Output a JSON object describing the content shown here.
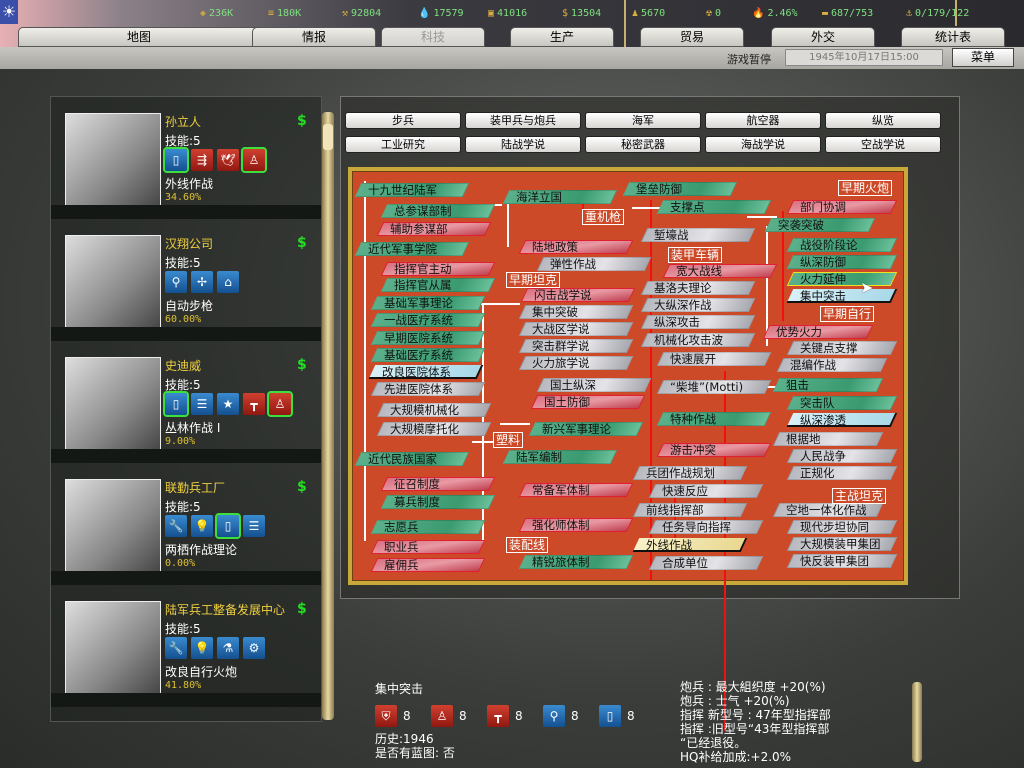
{
  "topbar": {
    "resources": [
      {
        "icon": "energy-icon",
        "value": "236K"
      },
      {
        "icon": "metal-icon",
        "value": "180K"
      },
      {
        "icon": "rare-materials-icon",
        "value": "92804"
      },
      {
        "icon": "oil-icon",
        "value": "17579"
      },
      {
        "icon": "supplies-icon",
        "value": "41016"
      },
      {
        "icon": "money-icon",
        "value": "13504"
      },
      {
        "icon": "manpower-icon",
        "value": "5670"
      },
      {
        "icon": "nuclear-icon",
        "value": "0"
      },
      {
        "icon": "dissent-icon",
        "value": "2.46%"
      },
      {
        "icon": "transport-icon",
        "value": "687/753"
      },
      {
        "icon": "convoy-icon",
        "value": "0/179/122"
      }
    ],
    "tabs": [
      "地图",
      "情报",
      "科技",
      "生产",
      "贸易",
      "外交",
      "统计表"
    ],
    "active_tab": "科技",
    "pause_label": "游戏暂停",
    "date": "1945年10月17日15:00",
    "menu_label": "菜单"
  },
  "teams": [
    {
      "name": "孙立人",
      "skill": "技能:5",
      "project": "外线作战",
      "progress": "34.60%",
      "icons": [
        [
          "book",
          "blue",
          true
        ],
        [
          "infantry-split",
          "red",
          false
        ],
        [
          "wings",
          "red",
          false
        ],
        [
          "soldier",
          "red",
          true
        ]
      ]
    },
    {
      "name": "汉翔公司",
      "skill": "技能:5",
      "project": "自动步枪",
      "progress": "60.00%",
      "icons": [
        [
          "rifle",
          "blue",
          false
        ],
        [
          "propeller",
          "blue",
          false
        ],
        [
          "factory",
          "blue",
          false
        ]
      ]
    },
    {
      "name": "史迪威",
      "skill": "技能:5",
      "project": "丛林作战 I",
      "progress": "9.00%",
      "icons": [
        [
          "book",
          "blue",
          true
        ],
        [
          "document-gear",
          "blue",
          false
        ],
        [
          "star",
          "blue",
          false
        ],
        [
          "hierarchy",
          "red",
          false
        ],
        [
          "soldier",
          "red",
          true
        ]
      ]
    },
    {
      "name": "联勤兵工厂",
      "skill": "技能:5",
      "project": "两栖作战理论",
      "progress": "0.00%",
      "icons": [
        [
          "wrench",
          "blue",
          false
        ],
        [
          "lightbulb",
          "blue",
          false
        ],
        [
          "book",
          "blue",
          true
        ],
        [
          "document-gear",
          "blue",
          false
        ]
      ]
    },
    {
      "name": "陆军兵工整备发展中心",
      "skill": "技能:5",
      "project": "改良自行火炮",
      "progress": "41.80%",
      "icons": [
        [
          "wrench",
          "blue",
          false
        ],
        [
          "lightbulb",
          "blue",
          false
        ],
        [
          "flask",
          "blue",
          false
        ],
        [
          "gears",
          "blue",
          false
        ]
      ]
    }
  ],
  "categories": {
    "row1": [
      "步兵",
      "装甲兵与炮兵",
      "海军",
      "航空器",
      "纵览"
    ],
    "row2": [
      "工业研究",
      "陆战学说",
      "秘密武器",
      "海战学说",
      "空战学说"
    ]
  },
  "tech_nodes": [
    {
      "name": "十九世纪陆军",
      "state": "researched"
    },
    {
      "name": "总参谋部制",
      "state": "researched"
    },
    {
      "name": "辅助参谋部",
      "state": "locked-alternative"
    },
    {
      "name": "近代军事学院",
      "state": "researched"
    },
    {
      "name": "指挥官主动",
      "state": "locked-alternative"
    },
    {
      "name": "指挥官从属",
      "state": "researched"
    },
    {
      "name": "基础军事理论",
      "state": "researched"
    },
    {
      "name": "一战医疗系统",
      "state": "researched"
    },
    {
      "name": "早期医院系统",
      "state": "researched"
    },
    {
      "name": "基础医疗系统",
      "state": "researched"
    },
    {
      "name": "改良医院体系",
      "state": "available"
    },
    {
      "name": "先进医院体系",
      "state": "unavailable"
    },
    {
      "name": "大规模机械化",
      "state": "unavailable"
    },
    {
      "name": "大规模摩托化",
      "state": "unavailable"
    },
    {
      "name": "近代民族国家",
      "state": "researched"
    },
    {
      "name": "征召制度",
      "state": "locked-alternative"
    },
    {
      "name": "募兵制度",
      "state": "researched"
    },
    {
      "name": "志愿兵",
      "state": "researched"
    },
    {
      "name": "职业兵",
      "state": "locked-alternative"
    },
    {
      "name": "雇佣兵",
      "state": "locked-alternative"
    },
    {
      "name": "海洋立国",
      "state": "researched"
    },
    {
      "name": "陆地政策",
      "state": "locked-alternative"
    },
    {
      "name": "弹性作战",
      "state": "unavailable"
    },
    {
      "name": "闪击战学说",
      "state": "locked-alternative"
    },
    {
      "name": "集中突破",
      "state": "unavailable"
    },
    {
      "name": "大战区学说",
      "state": "unavailable"
    },
    {
      "name": "突击群学说",
      "state": "unavailable"
    },
    {
      "name": "火力旅学说",
      "state": "unavailable"
    },
    {
      "name": "国土纵深",
      "state": "unavailable"
    },
    {
      "name": "国土防御",
      "state": "locked-alternative"
    },
    {
      "name": "新兴军事理论",
      "state": "researched"
    },
    {
      "name": "陆军编制",
      "state": "researched"
    },
    {
      "name": "常备军体制",
      "state": "locked-alternative"
    },
    {
      "name": "强化师体制",
      "state": "locked-alternative"
    },
    {
      "name": "精锐旅体制",
      "state": "researched"
    },
    {
      "name": "堡垒防御",
      "state": "researched"
    },
    {
      "name": "支撑点",
      "state": "researched"
    },
    {
      "name": "堑壕战",
      "state": "unavailable"
    },
    {
      "name": "宽大战线",
      "state": "locked-alternative"
    },
    {
      "name": "基洛夫理论",
      "state": "unavailable"
    },
    {
      "name": "大纵深作战",
      "state": "unavailable"
    },
    {
      "name": "纵深攻击",
      "state": "unavailable"
    },
    {
      "name": "机械化攻击波",
      "state": "unavailable"
    },
    {
      "name": "快速展开",
      "state": "unavailable"
    },
    {
      "name": "“柴堆”(Motti)",
      "state": "unavailable"
    },
    {
      "name": "特种作战",
      "state": "researched"
    },
    {
      "name": "游击冲突",
      "state": "locked-alternative"
    },
    {
      "name": "兵团作战规划",
      "state": "unavailable"
    },
    {
      "name": "快速反应",
      "state": "unavailable"
    },
    {
      "name": "前线指挥部",
      "state": "unavailable"
    },
    {
      "name": "任务导向指挥",
      "state": "unavailable"
    },
    {
      "name": "外线作战",
      "state": "researching"
    },
    {
      "name": "合成单位",
      "state": "unavailable"
    },
    {
      "name": "部门协调",
      "state": "locked-alternative"
    },
    {
      "name": "突袭突破",
      "state": "researched"
    },
    {
      "name": "战役阶段论",
      "state": "researched"
    },
    {
      "name": "纵深防御",
      "state": "researched"
    },
    {
      "name": "火力延伸",
      "state": "researched-hover"
    },
    {
      "name": "集中突击",
      "state": "available"
    },
    {
      "name": "优势火力",
      "state": "locked-alternative"
    },
    {
      "name": "关键点支撑",
      "state": "unavailable"
    },
    {
      "name": "混编作战",
      "state": "unavailable"
    },
    {
      "name": "狙击",
      "state": "researched"
    },
    {
      "name": "突击队",
      "state": "researched"
    },
    {
      "name": "纵深渗透",
      "state": "available"
    },
    {
      "name": "根据地",
      "state": "unavailable"
    },
    {
      "name": "人民战争",
      "state": "unavailable"
    },
    {
      "name": "正规化",
      "state": "unavailable"
    },
    {
      "name": "空地一体化作战",
      "state": "unavailable"
    },
    {
      "name": "现代步坦协同",
      "state": "unavailable"
    },
    {
      "name": "大规模装甲集团",
      "state": "unavailable"
    },
    {
      "name": "快反装甲集团",
      "state": "unavailable"
    }
  ],
  "dependency_labels": [
    "重机枪",
    "早期坦克",
    "装甲车辆",
    "早期火炮",
    "早期自行",
    "塑料",
    "装配线",
    "主战坦克"
  ],
  "info": {
    "title": "集中突击",
    "requirements": [
      {
        "icon": "artillery-icon",
        "color": "red",
        "value": "8"
      },
      {
        "icon": "soldier-icon",
        "color": "red",
        "value": "8"
      },
      {
        "icon": "hierarchy-icon",
        "color": "red",
        "value": "8"
      },
      {
        "icon": "rifle-icon",
        "color": "blue",
        "value": "8"
      },
      {
        "icon": "book-icon",
        "color": "blue",
        "value": "8"
      }
    ],
    "history": "历史:1946",
    "blueprint": "是否有蓝图: 否",
    "effects": [
      "炮兵 : 最大組织度  +20(%)",
      "炮兵 : 士气  +20(%)",
      "指挥  新型号 : 47年型指挥部",
      "指挥 :旧型号“43年型指挥部",
      "“已经退役。",
      "HQ补给加成:+2.0%"
    ]
  },
  "colors": {
    "tree_bg": "#cc4a28",
    "researched": "#3a9a70",
    "alternative": "#e89aa4",
    "unavailable": "#c8c8d0",
    "available": "#a8d8e8",
    "researching": "#e8d890"
  }
}
